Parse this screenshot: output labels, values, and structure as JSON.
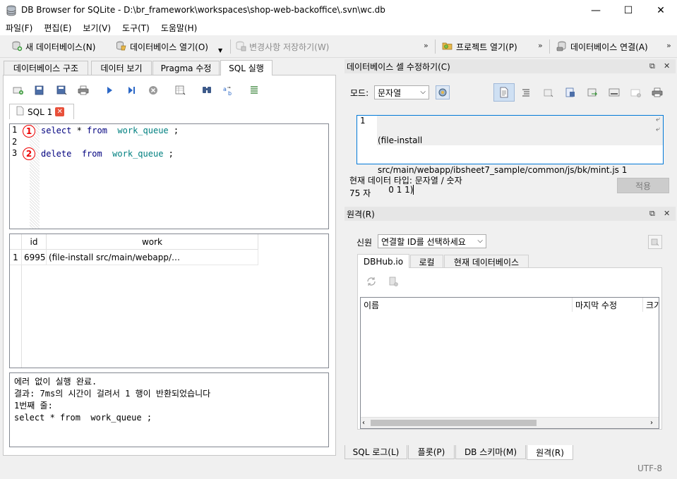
{
  "window": {
    "title": "DB Browser for SQLite - D:\\br_framework\\workspaces\\shop-web-backoffice\\.svn\\wc.db",
    "minimize": "—",
    "maximize": "☐",
    "close": "✕"
  },
  "menu": [
    "파일(F)",
    "편집(E)",
    "보기(V)",
    "도구(T)",
    "도움말(H)"
  ],
  "toolbar": {
    "new_db": "새 데이터베이스(N)",
    "open_db": "데이터베이스 열기(O)",
    "write_changes": "변경사항 저장하기(W)",
    "open_project": "프로젝트 열기(P)",
    "attach_db": "데이터베이스 연결(A)",
    "overflow": "»"
  },
  "main_tabs": [
    "데이터베이스 구조",
    "데이터 보기",
    "Pragma 수정",
    "SQL 실행"
  ],
  "sql": {
    "tab_label": "SQL 1",
    "lines": [
      {
        "num": "1",
        "marker": "1",
        "select": "select",
        "star": " * ",
        "from": "from",
        "table": "work_queue",
        "end": " ;"
      },
      {
        "num": "2"
      },
      {
        "num": "3",
        "marker": "2",
        "delete": "delete",
        "from": "from",
        "table": "work_queue",
        "end": " ;"
      }
    ]
  },
  "results": {
    "columns": [
      "id",
      "work"
    ],
    "rows": [
      {
        "row": "1",
        "id": "6995",
        "work": "(file-install src/main/webapp/…"
      }
    ]
  },
  "messages": [
    "에러 없이 실행 완료.",
    "결과: 7ms의 시간이 걸려서 1 행이 반환되었습니다",
    "1번째 줄:",
    "select * from  work_queue ;"
  ],
  "cell_editor": {
    "title": "데이터베이스 셀 수정하기(C)",
    "mode_label": "모드:",
    "mode_value": "문자열",
    "line_num": "1",
    "text_lines": [
      "(file-install",
      "src/main/webapp/ibsheet7_sample/common/js/bk/mint.js 1",
      "0 1 1)"
    ],
    "type_text": "현재 데이터 타입: 문자열 / 숫자",
    "size_text": "75 자",
    "apply": "적용",
    "wrap_glyph": "⤶"
  },
  "remote": {
    "title": "원격(R)",
    "identity_label": "신원",
    "identity_value": "연결할 ID를 선택하세요",
    "tabs": [
      "DBHub.io",
      "로컬",
      "현재 데이터베이스"
    ],
    "columns": [
      "이름",
      "마지막 수정",
      "크기"
    ]
  },
  "dock_controls": {
    "float": "⧉",
    "close": "✕"
  },
  "bottom_tabs": [
    "SQL 로그(L)",
    "플롯(P)",
    "DB 스키마(M)",
    "원격(R)"
  ],
  "status": {
    "encoding": "UTF-8"
  },
  "colors": {
    "keyword": "#00007f",
    "identifier": "#008080",
    "marker": "#e00000",
    "selection": "#0078d7"
  }
}
